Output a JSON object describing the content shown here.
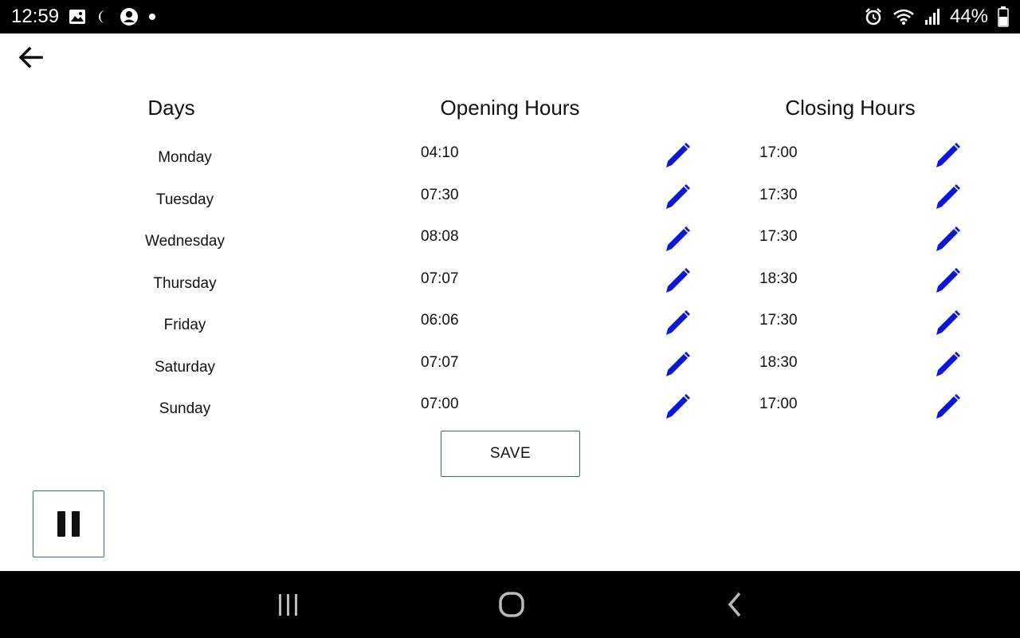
{
  "status_bar": {
    "time": "12:59",
    "battery": "44%",
    "left_icons": [
      "image-icon",
      "moon-icon",
      "account-icon",
      "dot-icon"
    ],
    "right_icons": [
      "alarm-icon",
      "wifi-icon",
      "signal-icon",
      "battery-icon"
    ]
  },
  "header": {
    "back_icon": "arrow-left-icon"
  },
  "columns": {
    "days": "Days",
    "opening": "Opening Hours",
    "closing": "Closing Hours"
  },
  "schedule": [
    {
      "day": "Monday",
      "open": "04:10",
      "close": "17:00"
    },
    {
      "day": "Tuesday",
      "open": "07:30",
      "close": "17:30"
    },
    {
      "day": "Wednesday",
      "open": "08:08",
      "close": "17:30"
    },
    {
      "day": "Thursday",
      "open": "07:07",
      "close": "18:30"
    },
    {
      "day": "Friday",
      "open": "06:06",
      "close": "17:30"
    },
    {
      "day": "Saturday",
      "open": "07:07",
      "close": "18:30"
    },
    {
      "day": "Sunday",
      "open": "07:00",
      "close": "17:00"
    }
  ],
  "actions": {
    "save_label": "SAVE"
  },
  "colors": {
    "edit_icon": "#0a16d8",
    "button_border": "#2a6f8f",
    "bars": "#000000"
  }
}
